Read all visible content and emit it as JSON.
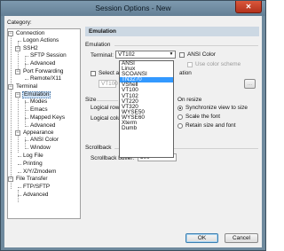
{
  "window": {
    "title": "Session Options - New",
    "close_glyph": "✕"
  },
  "category_label": "Category:",
  "tree": [
    {
      "label": "Connection",
      "expander": "−"
    },
    {
      "label": "Logon Actions"
    },
    {
      "label": "SSH2",
      "expander": "−"
    },
    {
      "label": "SFTP Session"
    },
    {
      "label": "Advanced"
    },
    {
      "label": "Port Forwarding",
      "expander": "−"
    },
    {
      "label": "Remote/X11"
    },
    {
      "label": "Terminal",
      "expander": "−"
    },
    {
      "label": "Emulation",
      "expander": "−",
      "selected": true
    },
    {
      "label": "Modes"
    },
    {
      "label": "Emacs"
    },
    {
      "label": "Mapped Keys"
    },
    {
      "label": "Advanced"
    },
    {
      "label": "Appearance",
      "expander": "−"
    },
    {
      "label": "ANSI Color"
    },
    {
      "label": "Window"
    },
    {
      "label": "Log File"
    },
    {
      "label": "Printing"
    },
    {
      "label": "X/Y/Zmodem"
    },
    {
      "label": "File Transfer",
      "expander": "−"
    },
    {
      "label": "FTP/SFTP"
    },
    {
      "label": "Advanced"
    }
  ],
  "panel": {
    "header": "Emulation",
    "emulation_group": "Emulation",
    "terminal_label": "Terminal:",
    "terminal_value": "VT102",
    "ansi_color": "ANSI Color",
    "use_color_scheme": "Use color scheme",
    "select_alt_partial": "Select a",
    "select_alt_suffix": "ation",
    "alt_value": "VT100",
    "browse": "...",
    "size_group": "Size",
    "logical_rows": "Logical rows",
    "logical_columns": "Logical colu",
    "on_resize_group": "On resize",
    "sync_view": "Synchronize view to size",
    "scale_font": "Scale the font",
    "retain_size": "Retain size and font",
    "scrollback_group": "Scrollback",
    "scrollback_label": "Scrollback buffer:",
    "scrollback_value": "500"
  },
  "dropdown_options": [
    "ANSI",
    "Linux",
    "SCOANSI",
    "TN3270",
    "VShell",
    "VT100",
    "VT102",
    "VT220",
    "VT320",
    "WYSE50",
    "WYSE60",
    "Xterm",
    "Dumb"
  ],
  "dropdown_highlighted": "TN3270",
  "buttons": {
    "ok": "OK",
    "cancel": "Cancel"
  },
  "colors": {
    "titlebar": "#6f8a9e",
    "highlight": "#3399ff",
    "panel_header": "#ccd8e3"
  }
}
